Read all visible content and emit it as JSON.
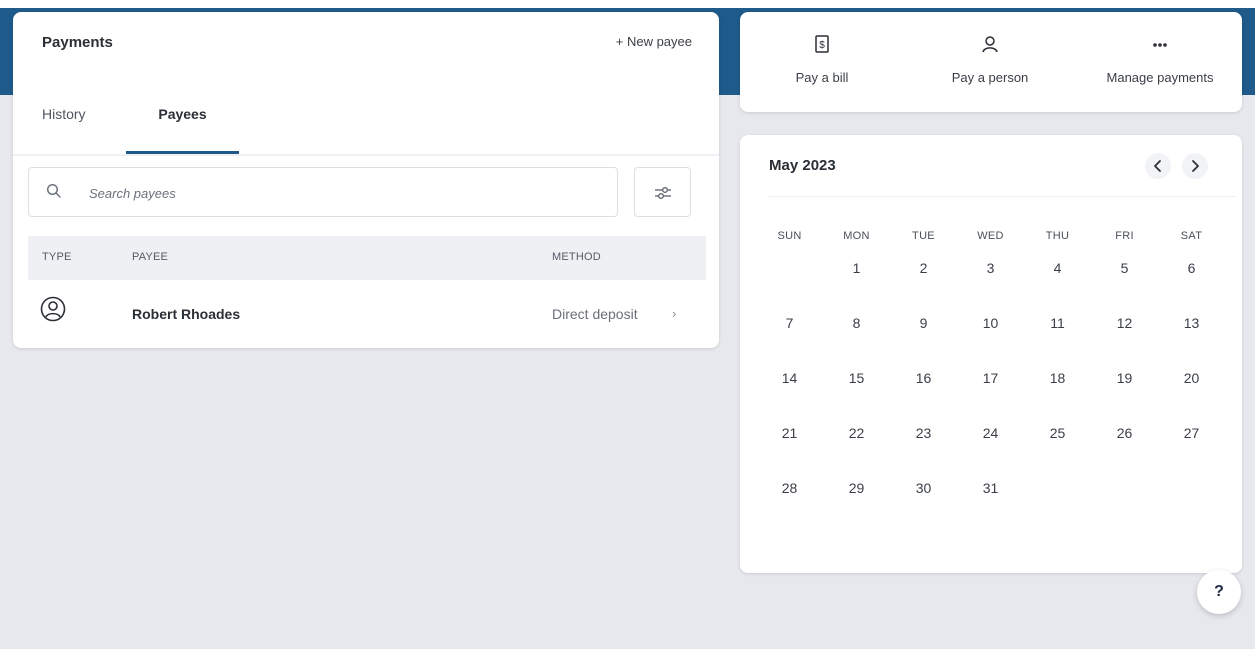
{
  "payments": {
    "title": "Payments",
    "new_payee_label": "+ New payee",
    "tabs": [
      {
        "label": "History",
        "active": false
      },
      {
        "label": "Payees",
        "active": true
      }
    ],
    "search": {
      "placeholder": "Search payees",
      "value": ""
    },
    "table": {
      "columns": [
        "TYPE",
        "PAYEE",
        "METHOD"
      ],
      "rows": [
        {
          "type_icon": "person-circle-icon",
          "payee": "Robert Rhoades",
          "method": "Direct deposit"
        }
      ]
    }
  },
  "actions": [
    {
      "label": "Pay a bill",
      "icon": "bill-icon"
    },
    {
      "label": "Pay a person",
      "icon": "person-icon"
    },
    {
      "label": "Manage payments",
      "icon": "more-icon"
    }
  ],
  "calendar": {
    "month_label": "May 2023",
    "weekdays": [
      "SUN",
      "MON",
      "TUE",
      "WED",
      "THU",
      "FRI",
      "SAT"
    ],
    "weeks": [
      [
        "",
        "1",
        "2",
        "3",
        "4",
        "5",
        "6"
      ],
      [
        "7",
        "8",
        "9",
        "10",
        "11",
        "12",
        "13"
      ],
      [
        "14",
        "15",
        "16",
        "17",
        "18",
        "19",
        "20"
      ],
      [
        "21",
        "22",
        "23",
        "24",
        "25",
        "26",
        "27"
      ],
      [
        "28",
        "29",
        "30",
        "31",
        "",
        "",
        ""
      ]
    ]
  },
  "help": {
    "label": "?"
  },
  "colors": {
    "brand_blue": "#1e5a8a",
    "background": "#e6e8ed",
    "table_header_bg": "#eef0f4"
  }
}
